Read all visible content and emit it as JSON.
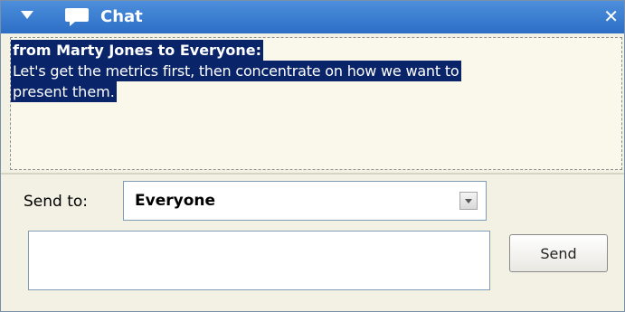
{
  "window": {
    "title": "Chat",
    "close_glyph": "✕",
    "collapse_icon": "triangle-down-icon",
    "title_icon": "speech-bubble-icon"
  },
  "messages": [
    {
      "header": "from Marty Jones to Everyone:",
      "body_line1": "Let's get the metrics first, then concentrate on how we want to",
      "body_line2": "present them."
    }
  ],
  "send_to": {
    "label": "Send to:",
    "selected": "Everyone"
  },
  "message_input": {
    "value": "",
    "placeholder": ""
  },
  "send_button": {
    "label": "Send"
  },
  "colors": {
    "titlebar": "#2c6ec6",
    "selection": "#0a246a",
    "panel_bg": "#f2f1e4"
  }
}
